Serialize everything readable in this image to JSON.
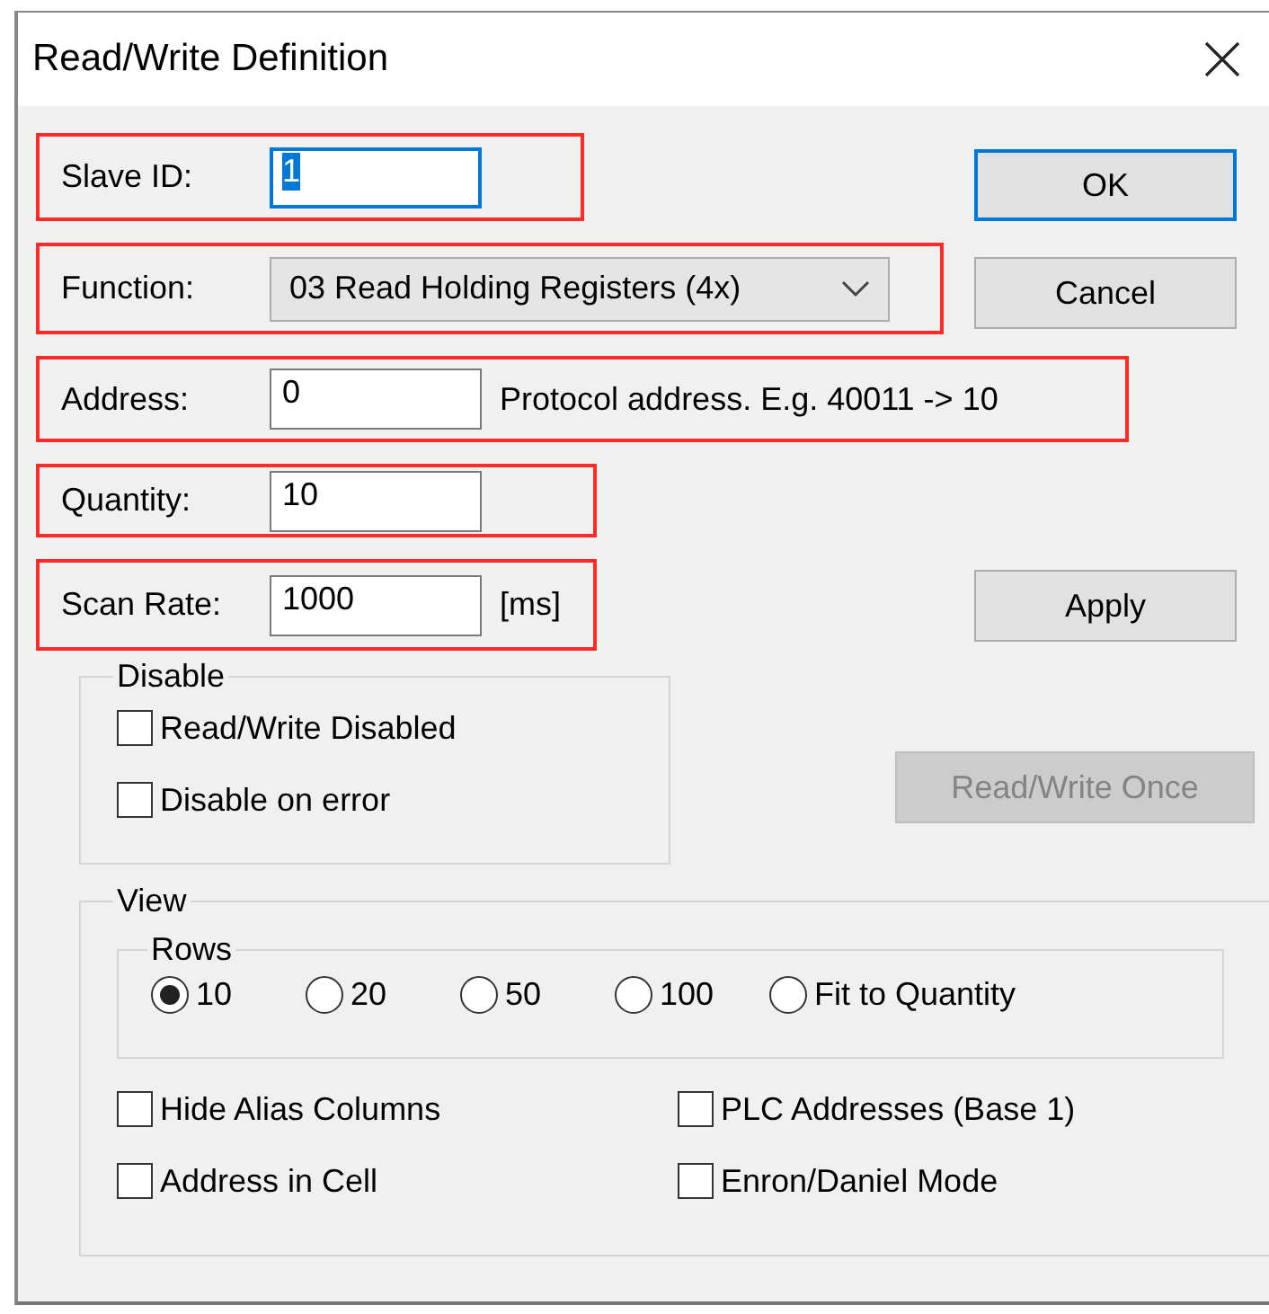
{
  "window": {
    "title": "Read/Write Definition"
  },
  "fields": [
    {
      "kind": "text",
      "label": "Slave ID:",
      "value": "1",
      "focused": true,
      "highlighted": true
    },
    {
      "kind": "dropdown",
      "label": "Function:",
      "value": "03 Read Holding Registers (4x)",
      "highlighted": true
    },
    {
      "kind": "text",
      "label": "Address:",
      "value": "0",
      "focused": false,
      "note": "Protocol address. E.g. 40011 -> 10",
      "highlighted": true
    },
    {
      "kind": "text",
      "label": "Quantity:",
      "value": "10",
      "focused": false,
      "highlighted": true
    },
    {
      "kind": "text",
      "label": "Scan Rate:",
      "value": "1000",
      "focused": false,
      "note": "[ms]",
      "highlighted": true
    }
  ],
  "buttons": [
    {
      "label": "OK",
      "default": true,
      "disabled": false
    },
    {
      "label": "Cancel",
      "default": false,
      "disabled": false
    },
    {
      "label": "Apply",
      "default": false,
      "disabled": false
    },
    {
      "label": "Read/Write Once",
      "default": false,
      "disabled": true
    }
  ],
  "disable_group": {
    "title": "Disable",
    "options": [
      {
        "label": "Read/Write Disabled",
        "checked": false
      },
      {
        "label": "Disable on error",
        "checked": false
      }
    ]
  },
  "view_group": {
    "title": "View",
    "rows": {
      "title": "Rows",
      "options": [
        {
          "label": "10",
          "selected": true
        },
        {
          "label": "20",
          "selected": false
        },
        {
          "label": "50",
          "selected": false
        },
        {
          "label": "100",
          "selected": false
        },
        {
          "label": "Fit to Quantity",
          "selected": false
        }
      ]
    },
    "options": [
      {
        "label": "Hide Alias Columns",
        "checked": false
      },
      {
        "label": "PLC Addresses (Base 1)",
        "checked": false
      },
      {
        "label": "Address in Cell",
        "checked": false
      },
      {
        "label": "Enron/Daniel Mode",
        "checked": false
      }
    ]
  }
}
